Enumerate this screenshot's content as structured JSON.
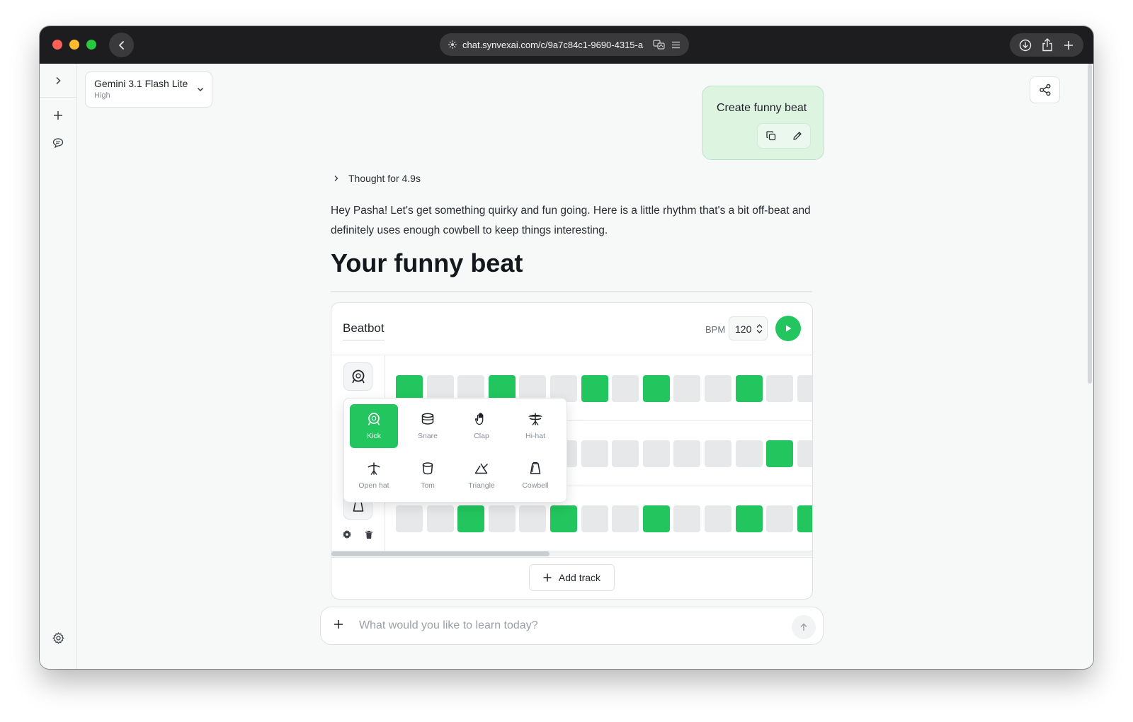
{
  "browser": {
    "url": "chat.synvexai.com/c/9a7c84c1-9690-4315-a"
  },
  "model_selector": {
    "name": "Gemini 3.1 Flash Lite",
    "level": "High"
  },
  "user_message": {
    "text": "Create funny beat"
  },
  "assistant": {
    "thought_label": "Thought for 4.9s",
    "reply": "Hey Pasha! Let's get something quirky and fun going. Here is a little rhythm that's a bit off-beat and definitely uses enough cowbell to keep things interesting.",
    "heading": "Your funny beat"
  },
  "beatbot": {
    "title": "Beatbot",
    "bpm_label": "BPM",
    "bpm_value": "120",
    "add_track_label": "Add track",
    "tracks": [
      {
        "instrument": "Kick",
        "steps": [
          1,
          0,
          0,
          1,
          0,
          0,
          1,
          0,
          1,
          0,
          0,
          1,
          0,
          0
        ]
      },
      {
        "instrument": "Hi-hat",
        "steps": [
          0,
          0,
          0,
          0,
          0,
          0,
          0,
          0,
          0,
          0,
          0,
          0,
          1,
          0
        ]
      },
      {
        "instrument": "Cowbell",
        "steps": [
          0,
          0,
          1,
          0,
          0,
          1,
          0,
          0,
          1,
          0,
          0,
          1,
          0,
          1
        ]
      }
    ],
    "instrument_menu": [
      {
        "label": "Kick",
        "icon": "kick-drum-icon",
        "selected": true
      },
      {
        "label": "Snare",
        "icon": "snare-drum-icon",
        "selected": false
      },
      {
        "label": "Clap",
        "icon": "hand-icon",
        "selected": false
      },
      {
        "label": "Hi-hat",
        "icon": "hi-hat-icon",
        "selected": false
      },
      {
        "label": "Open hat",
        "icon": "open-hat-icon",
        "selected": false
      },
      {
        "label": "Tom",
        "icon": "tom-drum-icon",
        "selected": false
      },
      {
        "label": "Triangle",
        "icon": "triangle-icon",
        "selected": false
      },
      {
        "label": "Cowbell",
        "icon": "cowbell-icon",
        "selected": false
      }
    ]
  },
  "composer": {
    "placeholder": "What would you like to learn today?"
  },
  "colors": {
    "accent_green": "#22c55e",
    "user_bubble": "#ddf4e1",
    "step_off": "#e6e8ea"
  }
}
